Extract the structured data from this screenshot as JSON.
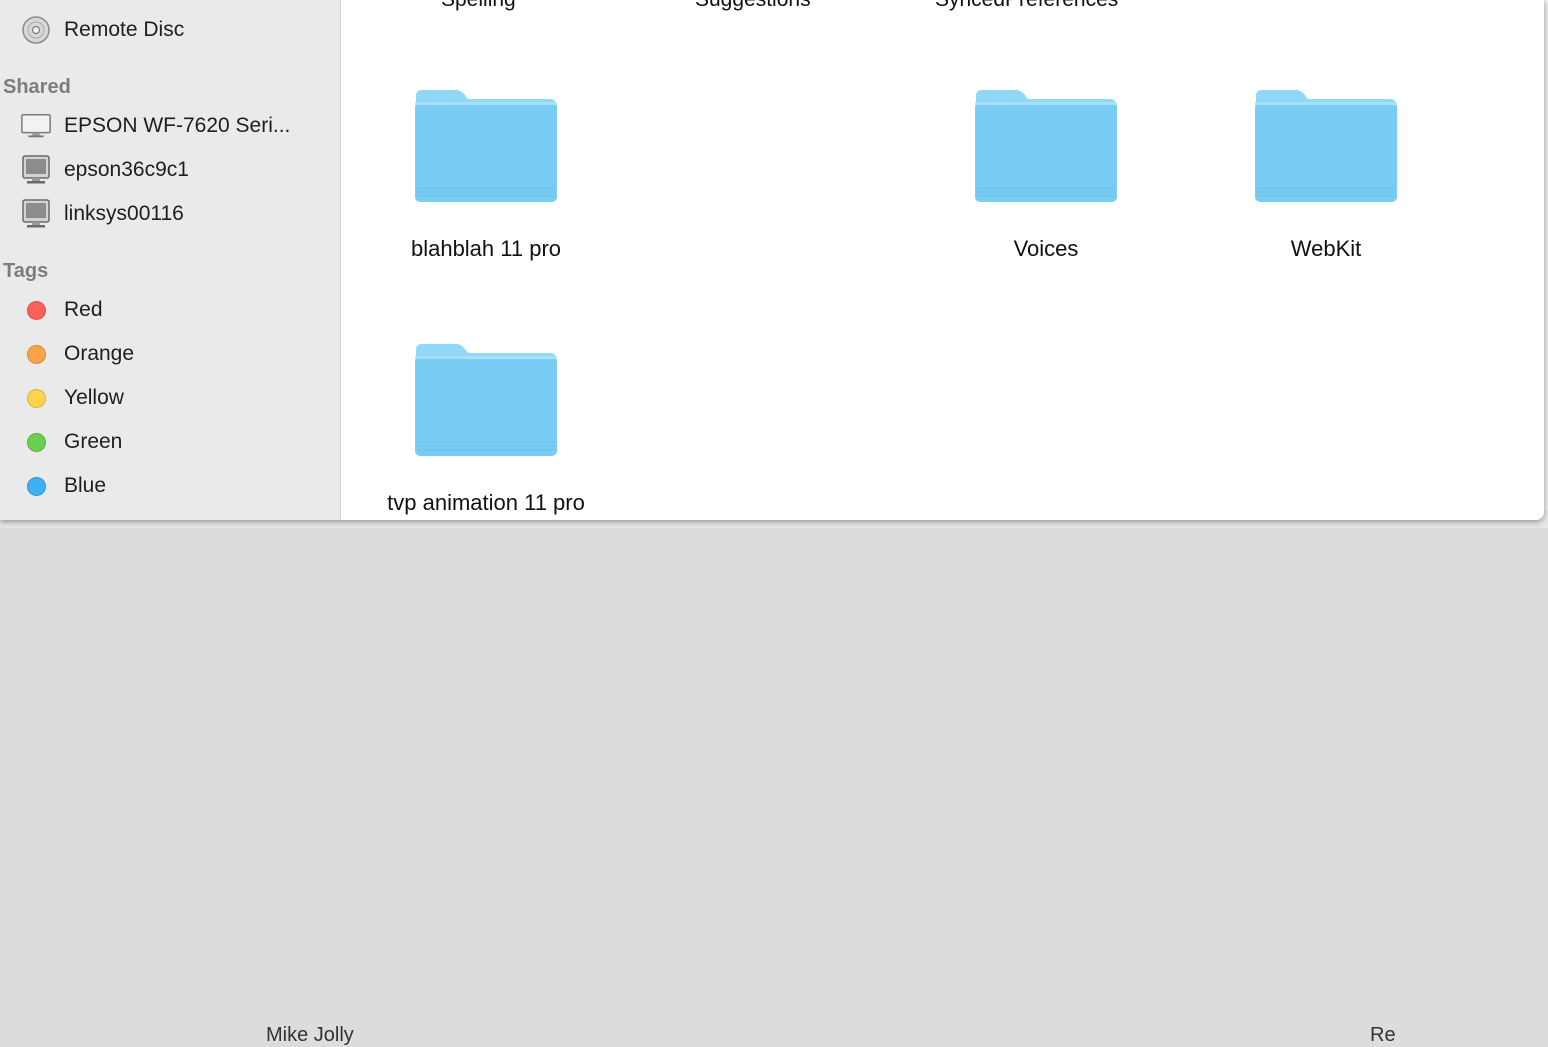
{
  "sidebar": {
    "devices": [
      {
        "label": "Remote Disc",
        "icon": "disc-icon"
      }
    ],
    "shared_header": "Shared",
    "shared": [
      {
        "label": "EPSON WF-7620 Seri...",
        "icon": "display-icon"
      },
      {
        "label": "epson36c9c1",
        "icon": "computer-icon"
      },
      {
        "label": "linksys00116",
        "icon": "computer-icon"
      }
    ],
    "tags_header": "Tags",
    "tags": [
      {
        "label": "Red",
        "color": "#fc605c"
      },
      {
        "label": "Orange",
        "color": "#fca246"
      },
      {
        "label": "Yellow",
        "color": "#fcd34c"
      },
      {
        "label": "Green",
        "color": "#6ccf4d"
      },
      {
        "label": "Blue",
        "color": "#3fb0f5"
      }
    ]
  },
  "content": {
    "top_labels": [
      "Spelling",
      "Suggestions",
      "SyncedPreferences"
    ],
    "folders": [
      {
        "name": "blahblah 11 pro"
      },
      {
        "name": "Voices"
      },
      {
        "name": "WebKit"
      },
      {
        "name": "tvp animation 11 pro"
      }
    ]
  },
  "background": {
    "bottom_left_text": "Mike Jolly",
    "bottom_right_text": "Re"
  },
  "colors": {
    "folder_light": "#8fd8f7",
    "folder_main": "#79cdf4",
    "sidebar_bg": "#eaeaea",
    "section_header": "#7d7d7d"
  }
}
